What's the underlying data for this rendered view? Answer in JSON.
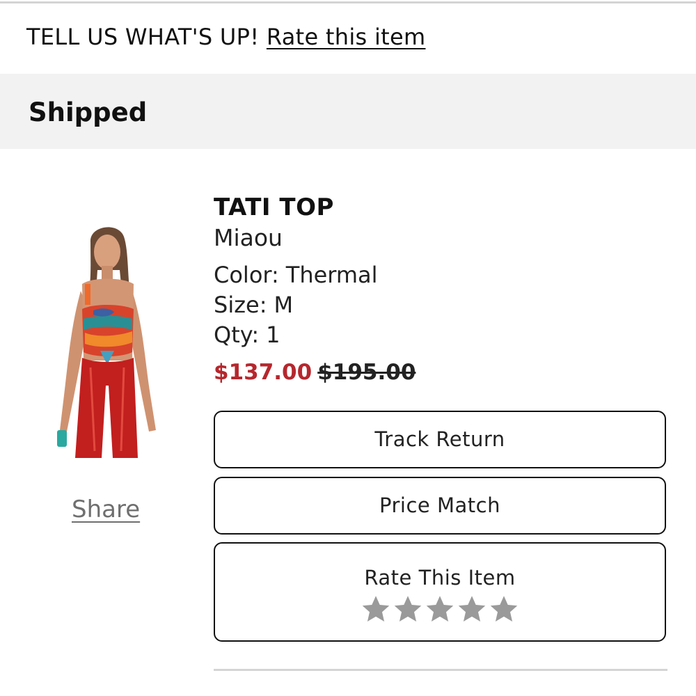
{
  "feedback": {
    "prompt": "TELL US WHAT'S UP!",
    "link": "Rate this item"
  },
  "status": {
    "label": "Shipped"
  },
  "product": {
    "name": "TATI TOP",
    "brand": "Miaou",
    "color_label": "Color:",
    "color_value": "Thermal",
    "size_label": "Size:",
    "size_value": "M",
    "qty_label": "Qty:",
    "qty_value": "1",
    "sale_price": "$137.00",
    "original_price": "$195.00",
    "sale_price_color": "#b5272d",
    "image_icon": "product-photo-model-wearing-top"
  },
  "share": {
    "label": "Share"
  },
  "actions": {
    "track_return": "Track Return",
    "price_match": "Price Match",
    "rate_item": "Rate This Item",
    "rating_value": 0,
    "rating_max": 5,
    "star_color": "#9a9a9a"
  }
}
